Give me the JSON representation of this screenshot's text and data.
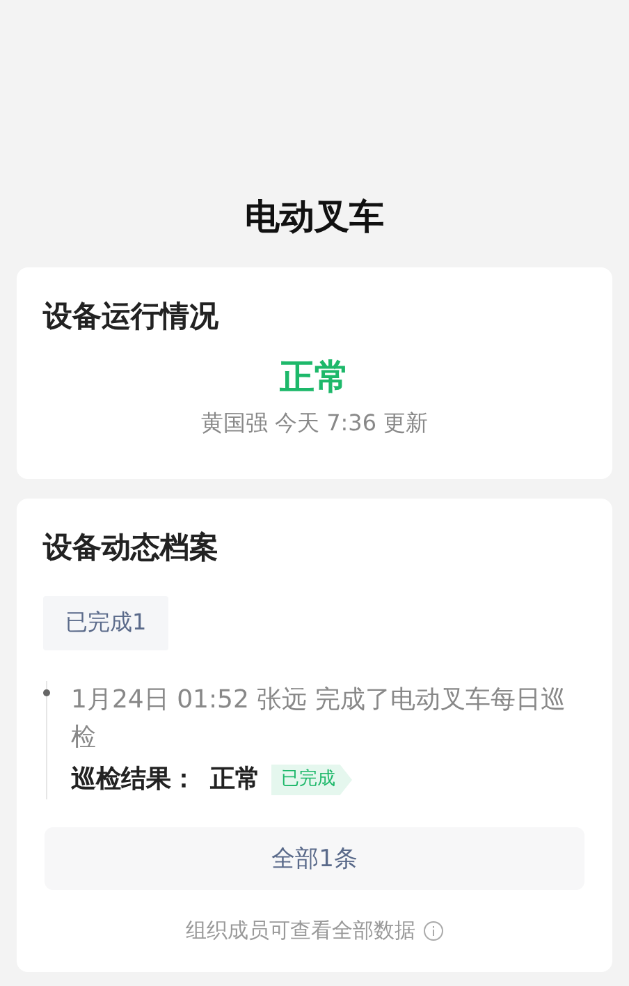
{
  "page": {
    "title": "电动叉车"
  },
  "status_card": {
    "title": "设备运行情况",
    "status": {
      "text": "正常",
      "kind": "normal"
    },
    "updated": "黄国强 今天 7:36 更新"
  },
  "archive_card": {
    "title": "设备动态档案",
    "tabs": [
      {
        "label": "已完成1",
        "selected": true
      }
    ],
    "records": [
      {
        "text": "1月24日 01:52  张远 完成了电动叉车每日巡检",
        "result_label": "巡检结果：",
        "result": "正常",
        "tag": {
          "text": "已完成",
          "kind": "done"
        }
      }
    ],
    "all_button": "全部1条",
    "footer": "组织成员可查看全部数据"
  }
}
